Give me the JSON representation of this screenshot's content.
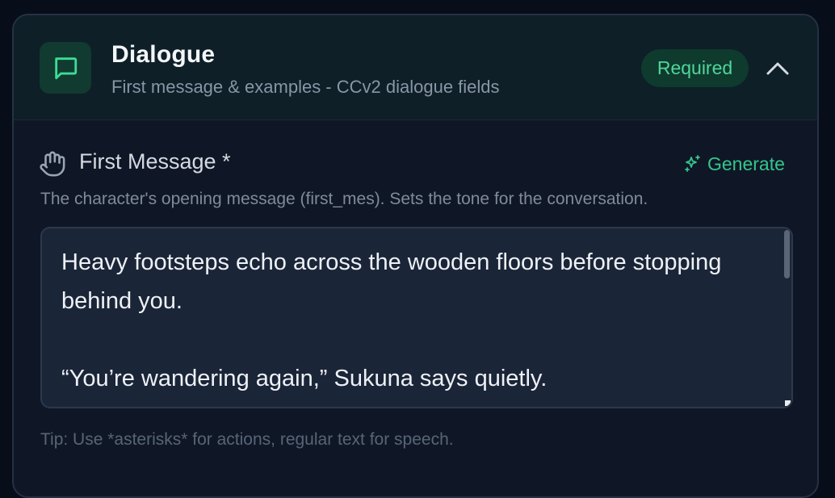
{
  "header": {
    "icon": "message-square-icon",
    "title": "Dialogue",
    "subtitle": "First message & examples - CCv2 dialogue fields",
    "badge": "Required",
    "toggle_icon": "chevron-up-icon"
  },
  "field": {
    "icon": "hand-icon",
    "label": "First Message *",
    "generate_icon": "sparkles-icon",
    "generate_label": "Generate",
    "description": "The character's opening message (first_mes). Sets the tone for the conversation.",
    "value": "Heavy footsteps echo across the wooden floors before stopping behind you.\n\n“You’re wandering again,” Sukuna says quietly.",
    "tip": "Tip: Use *asterisks* for actions, regular text for speech."
  },
  "colors": {
    "accent": "#35c58c",
    "badge_text": "#4fd69b",
    "background": "#080d1a",
    "card": "#0f1726"
  }
}
